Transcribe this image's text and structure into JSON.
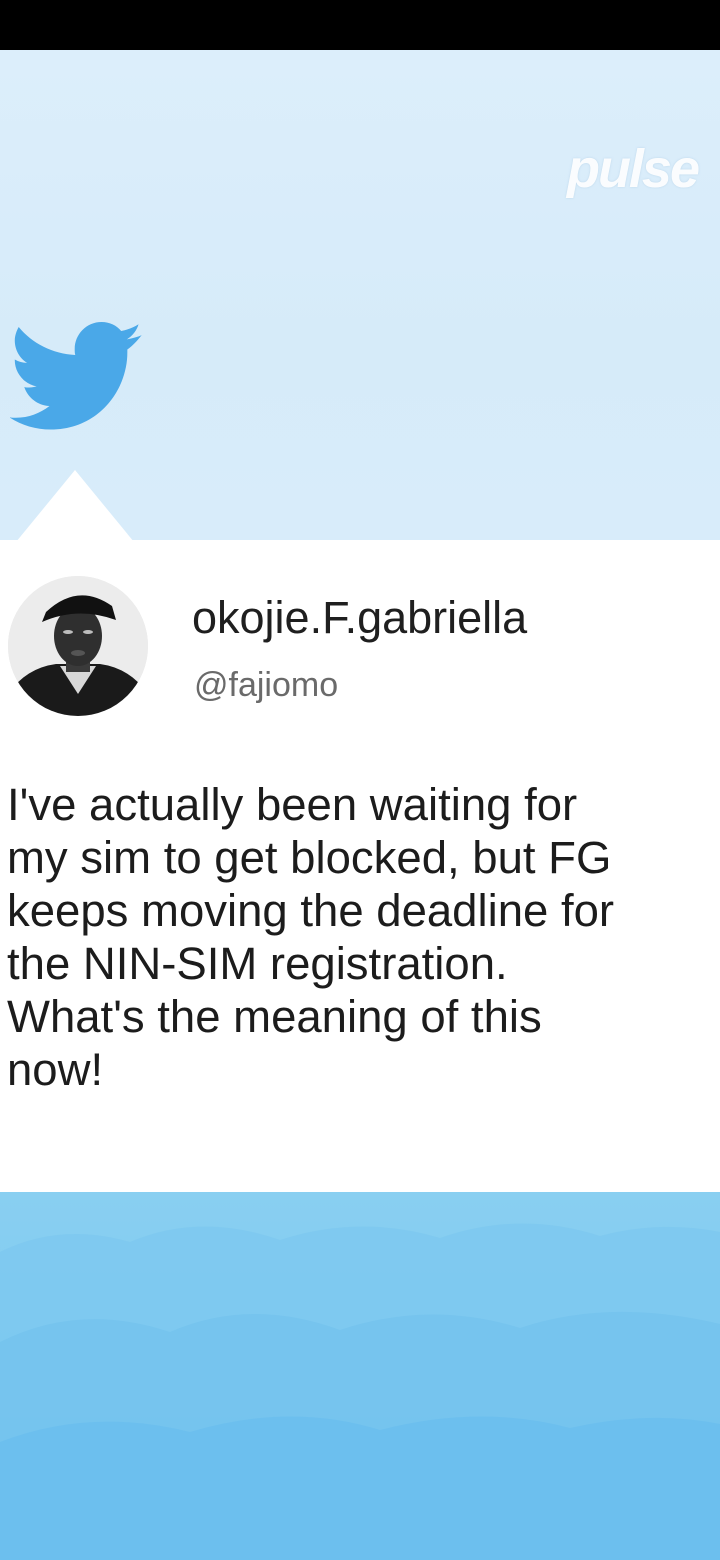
{
  "brand": {
    "logo_text": "pulse"
  },
  "tweet": {
    "display_name": "okojie.F.gabriella",
    "handle": "@fajiomo",
    "text_lines": [
      "I've actually been waiting for",
      "my sim to get blocked, but FG",
      "keeps moving the deadline for",
      "the NIN-SIM registration.",
      "What's the meaning of this",
      "now!"
    ]
  },
  "icons": {
    "social": "twitter-bird-icon",
    "avatar": "avatar"
  },
  "colors": {
    "twitter_blue": "#4aa8e8",
    "sky_top": "#dceefb",
    "sky_bottom": "#7fcaf0",
    "card": "#ffffff"
  }
}
